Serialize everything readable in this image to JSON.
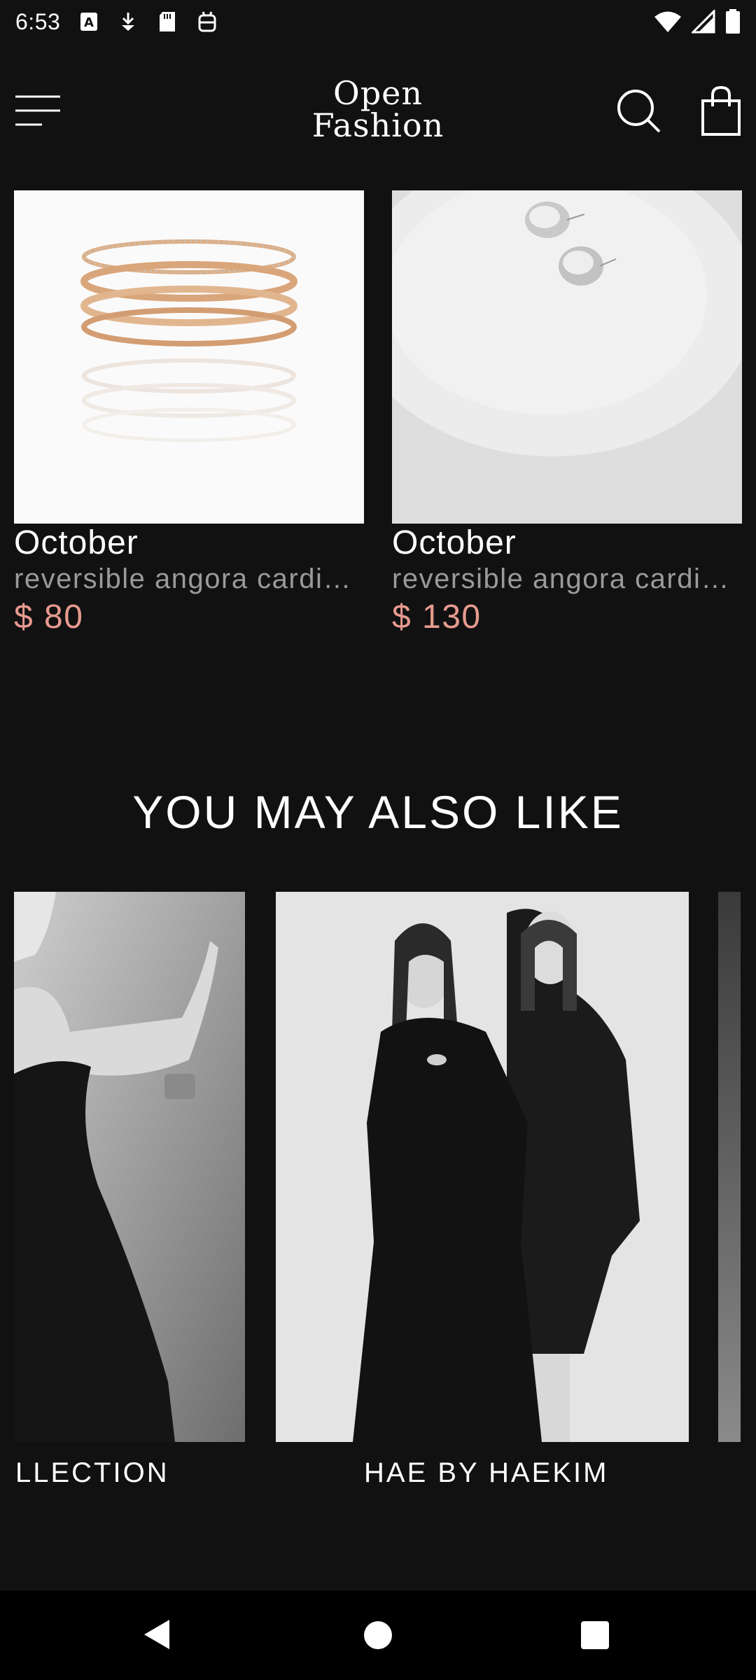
{
  "status_bar": {
    "time": "6:53",
    "left_icons": [
      "keyboard-a-icon",
      "download-icon",
      "sd-card-icon",
      "android-icon"
    ],
    "right_icons": [
      "wifi-icon",
      "cellular-icon",
      "battery-icon"
    ]
  },
  "header": {
    "logo_line1": "Open",
    "logo_line2": "Fashion",
    "menu_icon": "menu-icon",
    "search_icon": "search-icon",
    "bag_icon": "shopping-bag-icon"
  },
  "products": [
    {
      "name": "October",
      "desc": "reversible angora cardigan",
      "price": "$ 80",
      "image": "rose-gold-ring"
    },
    {
      "name": "October",
      "desc": "reversible angora cardigan",
      "price": "$ 130",
      "image": "silver-earrings"
    }
  ],
  "section": {
    "title": "YOU MAY ALSO LIKE"
  },
  "carousel": [
    {
      "label": "LLECTION"
    },
    {
      "label": "HAE BY HAEKIM"
    }
  ],
  "colors": {
    "background": "#111111",
    "price": "#e79a8f",
    "desc": "#9a9a9a"
  }
}
